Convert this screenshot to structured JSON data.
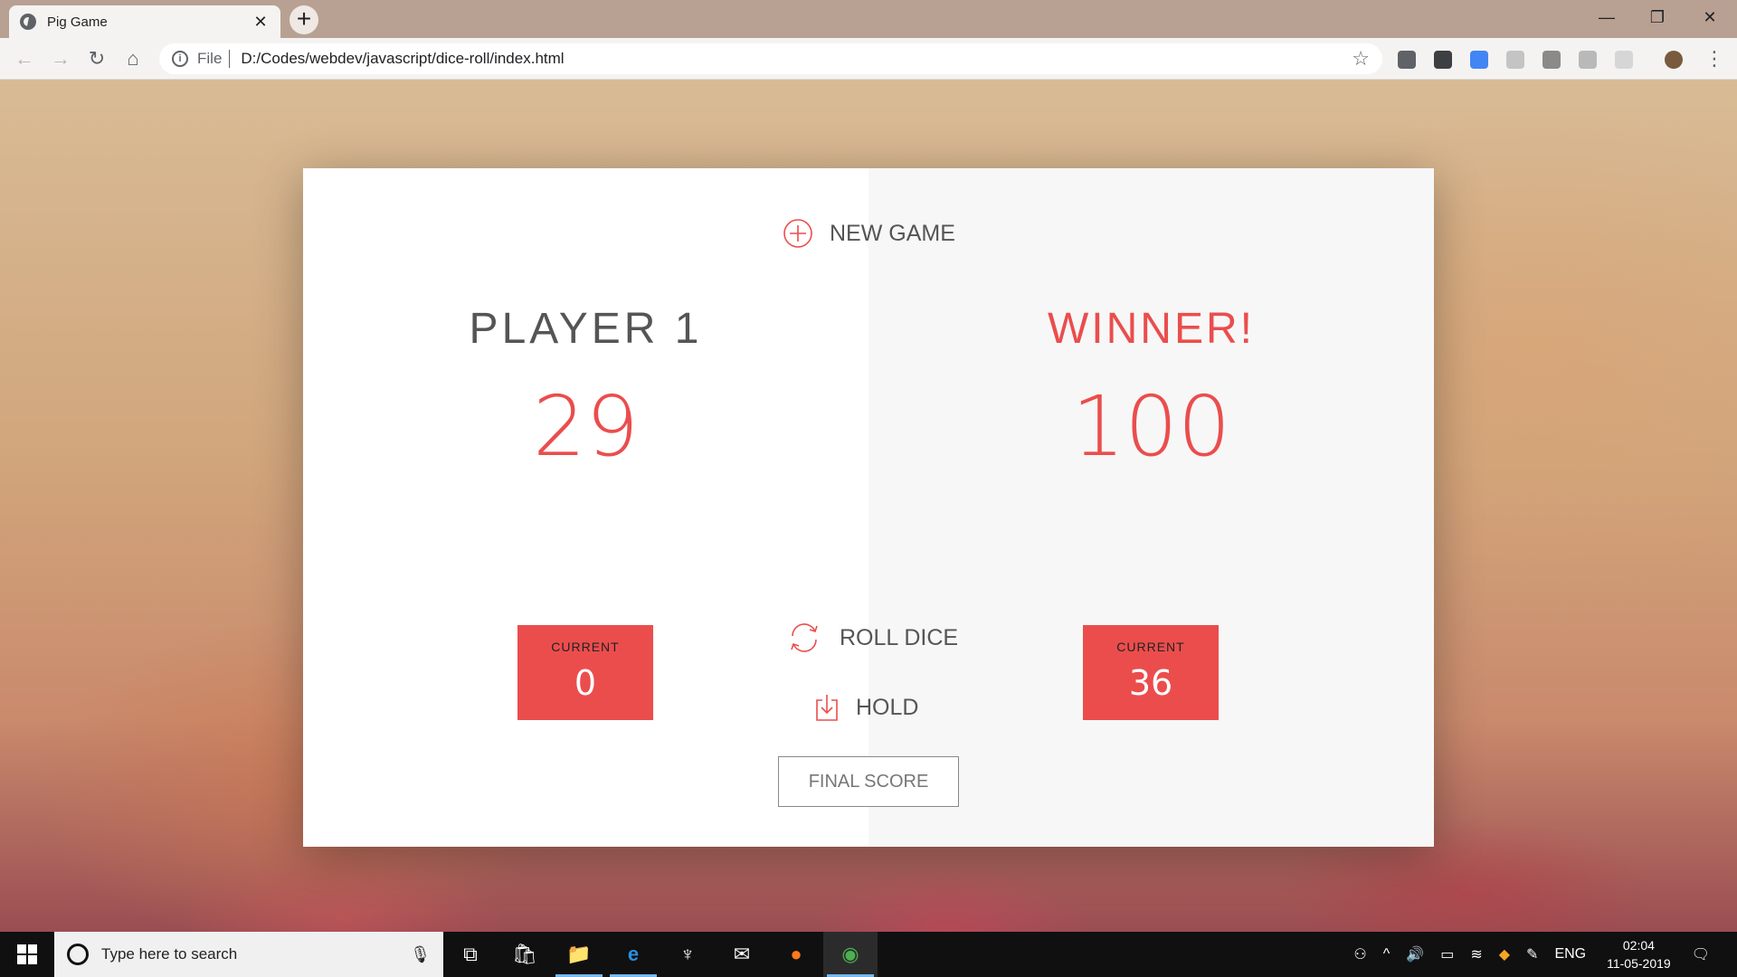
{
  "browser": {
    "tab_title": "Pig Game",
    "tab_close": "✕",
    "new_tab": "+",
    "scheme": "File",
    "url": "D:/Codes/webdev/javascript/dice-roll/index.html",
    "controls": {
      "minimize": "—",
      "restore": "❐",
      "close": "✕"
    }
  },
  "game": {
    "new_game_label": "New game",
    "player_0": {
      "name": "Player 1",
      "score": "29",
      "current_label": "Current",
      "current": "0"
    },
    "player_1": {
      "name": "Winner!",
      "score": "100",
      "current_label": "Current",
      "current": "36"
    },
    "roll_label": "Roll dice",
    "hold_label": "Hold",
    "final_score_label": "Final score",
    "accent_color": "#eb4d4d"
  },
  "taskbar": {
    "search_placeholder": "Type here to search",
    "language": "ENG",
    "time": "02:04",
    "date": "11-05-2019"
  }
}
